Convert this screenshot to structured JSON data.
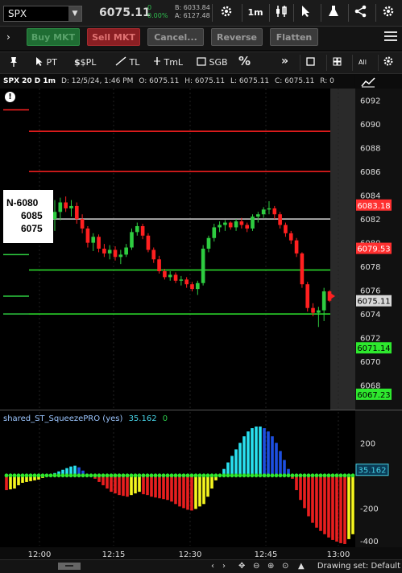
{
  "header": {
    "symbol": "SPX",
    "last_price": "6075.11",
    "net_change": "0",
    "net_change_pct": "0.00%",
    "bid_label": "B: 6033.84",
    "ask_label": "A: 6127.48",
    "timeframe": "1m"
  },
  "trade_bar": {
    "buy_label": "Buy MKT",
    "sell_label": "Sell MKT",
    "cancel_label": "Cancel...",
    "reverse_label": "Reverse",
    "flatten_label": "Flatten"
  },
  "draw_toolbar": {
    "pt_label": "PT",
    "pl_label": "$PL",
    "tl_label": "TL",
    "tml_label": "TmL",
    "sgb_label": "SGB",
    "pct_label": "%",
    "more_label": "»",
    "all_label": "All"
  },
  "chart_header": {
    "symbol_label": "SPX 20 D 1m",
    "date_label": "D: 12/5/24, 1:46 PM",
    "open_label": "O: 6075.11",
    "high_label": "H: 6075.11",
    "low_label": "L: 6075.11",
    "close_label": "C: 6075.11",
    "range_label": "R: 0"
  },
  "note": {
    "line1": "N-6080",
    "line2": "6085",
    "line3": "6075"
  },
  "lower_study": {
    "name": "shared_ST_SqueezePRO (yes)",
    "value": "35.162",
    "value2": "0",
    "value_tag": "35.162"
  },
  "status_bar": {
    "drawing_set_label": "Drawing set: Default"
  },
  "colors": {
    "up": "#2ecc40",
    "down": "#ff2020",
    "hist_light_blue": "#29e0f0",
    "hist_blue": "#1d4fe0",
    "hist_red": "#e81f1f",
    "hist_yellow": "#f5f51e",
    "squeeze_dot": "#2ee82e"
  },
  "chart_data": [
    {
      "type": "candlestick",
      "title": "SPX 20 D 1m",
      "ylim": [
        6066,
        6093
      ],
      "x_ticks": [
        "12:00",
        "12:15",
        "12:30",
        "12:45",
        "13:00"
      ],
      "y_ticks": [
        6092,
        6090,
        6088,
        6086,
        6084,
        6082,
        6080,
        6078,
        6076,
        6074,
        6072,
        6070,
        6068
      ],
      "price_tags": [
        {
          "label": "6083.18",
          "value": 6083.18,
          "color": "#ff3030"
        },
        {
          "label": "6079.53",
          "value": 6079.53,
          "color": "#ff3030"
        },
        {
          "label": "6075.11",
          "value": 6075.11,
          "color": "#d8d8d8"
        },
        {
          "label": "6071.14",
          "value": 6071.14,
          "color": "#2ee82e"
        },
        {
          "label": "6067.23",
          "value": 6067.23,
          "color": "#2ee82e"
        }
      ],
      "horizontal_levels": [
        {
          "value": 6089.4,
          "color": "#ff2020"
        },
        {
          "value": 6086.0,
          "color": "#ff2020"
        },
        {
          "value": 6082.0,
          "color": "#d8d8d8"
        },
        {
          "value": 6077.7,
          "color": "#2ee82e"
        },
        {
          "value": 6074.0,
          "color": "#2ee82e"
        }
      ],
      "candles": [
        [
          6082.0,
          6083.6,
          6081.0,
          6082.6
        ],
        [
          6082.6,
          6083.8,
          6081.9,
          6083.4
        ],
        [
          6083.4,
          6083.9,
          6082.6,
          6082.9
        ],
        [
          6082.9,
          6083.6,
          6082.2,
          6083.1
        ],
        [
          6083.1,
          6083.4,
          6081.6,
          6082.0
        ],
        [
          6082.0,
          6082.4,
          6080.8,
          6081.2
        ],
        [
          6081.2,
          6081.4,
          6079.6,
          6080.0
        ],
        [
          6080.0,
          6080.8,
          6079.3,
          6080.5
        ],
        [
          6080.5,
          6080.7,
          6079.2,
          6079.5
        ],
        [
          6079.5,
          6079.9,
          6078.8,
          6079.1
        ],
        [
          6079.1,
          6079.8,
          6078.6,
          6079.4
        ],
        [
          6079.4,
          6079.7,
          6078.5,
          6078.8
        ],
        [
          6078.8,
          6079.4,
          6078.2,
          6079.0
        ],
        [
          6079.0,
          6079.9,
          6078.8,
          6079.6
        ],
        [
          6079.6,
          6081.2,
          6079.4,
          6080.9
        ],
        [
          6080.9,
          6081.7,
          6080.6,
          6081.4
        ],
        [
          6081.4,
          6081.6,
          6080.3,
          6080.6
        ],
        [
          6080.6,
          6080.8,
          6079.2,
          6079.4
        ],
        [
          6079.4,
          6079.6,
          6078.3,
          6078.6
        ],
        [
          6078.6,
          6078.9,
          6077.4,
          6077.6
        ],
        [
          6077.6,
          6077.8,
          6076.9,
          6077.1
        ],
        [
          6077.1,
          6077.6,
          6076.8,
          6077.3
        ],
        [
          6077.3,
          6077.5,
          6076.6,
          6076.8
        ],
        [
          6076.8,
          6077.2,
          6076.4,
          6076.9
        ],
        [
          6076.9,
          6077.1,
          6076.2,
          6076.5
        ],
        [
          6076.5,
          6076.7,
          6075.9,
          6076.1
        ],
        [
          6076.1,
          6076.8,
          6075.6,
          6076.6
        ],
        [
          6076.6,
          6079.8,
          6076.4,
          6079.5
        ],
        [
          6079.5,
          6080.6,
          6079.2,
          6080.4
        ],
        [
          6080.4,
          6081.6,
          6080.1,
          6081.3
        ],
        [
          6081.3,
          6081.8,
          6080.9,
          6081.5
        ],
        [
          6081.5,
          6081.9,
          6081.0,
          6081.7
        ],
        [
          6081.7,
          6081.8,
          6081.1,
          6081.3
        ],
        [
          6081.3,
          6082.0,
          6081.0,
          6081.8
        ],
        [
          6081.8,
          6082.1,
          6081.2,
          6081.5
        ],
        [
          6081.5,
          6081.7,
          6080.9,
          6081.2
        ],
        [
          6081.2,
          6082.4,
          6081.0,
          6082.2
        ],
        [
          6082.2,
          6082.6,
          6081.7,
          6082.4
        ],
        [
          6082.4,
          6083.0,
          6082.1,
          6082.8
        ],
        [
          6082.8,
          6083.5,
          6082.4,
          6082.9
        ],
        [
          6082.9,
          6083.1,
          6082.0,
          6082.4
        ],
        [
          6082.4,
          6082.6,
          6081.2,
          6081.5
        ],
        [
          6081.5,
          6081.7,
          6080.5,
          6080.8
        ],
        [
          6080.8,
          6081.0,
          6079.9,
          6080.2
        ],
        [
          6080.2,
          6080.4,
          6078.8,
          6079.1
        ],
        [
          6079.1,
          6079.2,
          6076.2,
          6076.5
        ],
        [
          6076.5,
          6076.7,
          6074.2,
          6074.5
        ],
        [
          6074.5,
          6074.9,
          6073.8,
          6074.1
        ],
        [
          6074.1,
          6074.6,
          6072.9,
          6074.3
        ],
        [
          6074.3,
          6076.2,
          6073.4,
          6075.9
        ],
        [
          6075.9,
          6076.0,
          6075.0,
          6075.11
        ]
      ]
    },
    {
      "type": "bar",
      "title": "shared_ST_SqueezePRO (yes)",
      "ylim": [
        -430,
        300
      ],
      "y_ticks": [
        200,
        0,
        -200,
        -400
      ],
      "values": [
        -90,
        -85,
        -80,
        -60,
        -45,
        -40,
        -35,
        -30,
        -25,
        -15,
        -5,
        5,
        15,
        25,
        35,
        45,
        55,
        60,
        50,
        30,
        10,
        0,
        -20,
        -40,
        -60,
        -80,
        -100,
        -110,
        -120,
        -125,
        -130,
        -120,
        -110,
        -100,
        -115,
        -120,
        -130,
        -135,
        -140,
        -145,
        -150,
        -160,
        -175,
        -190,
        -200,
        -210,
        -215,
        -205,
        -190,
        -175,
        -130,
        -80,
        -30,
        0,
        40,
        80,
        120,
        160,
        200,
        240,
        270,
        290,
        300,
        300,
        290,
        270,
        240,
        200,
        150,
        95,
        40,
        -20,
        -90,
        -150,
        -200,
        -250,
        -290,
        -320,
        -340,
        -360,
        -380,
        -395,
        -405,
        -415,
        -420,
        -390,
        -360
      ],
      "dot_color": "#2ee82e"
    }
  ]
}
